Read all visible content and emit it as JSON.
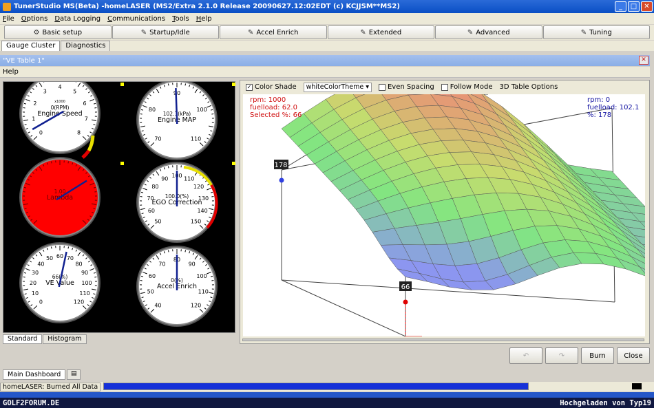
{
  "window": {
    "title": "TunerStudio MS(Beta)  -homeLASER (MS2/Extra 2.1.0 Release  20090627.12:02EDT (c) KCJJSM**MS2)"
  },
  "menu": [
    "File",
    "Options",
    "Data Logging",
    "Communications",
    "Tools",
    "Help"
  ],
  "toolbar": [
    {
      "label": "Basic setup",
      "icon": "basic-setup-icon"
    },
    {
      "label": "Startup/Idle",
      "icon": "startup-idle-icon"
    },
    {
      "label": "Accel Enrich",
      "icon": "accel-enrich-icon"
    },
    {
      "label": "Extended",
      "icon": "extended-icon"
    },
    {
      "label": "Advanced",
      "icon": "advanced-icon"
    },
    {
      "label": "Tuning",
      "icon": "tuning-icon"
    }
  ],
  "main_tabs": [
    "Gauge Cluster",
    "Diagnostics"
  ],
  "inner_window": {
    "title": "\"VE Table 1\"",
    "menu_help": "Help"
  },
  "gauges": [
    {
      "name": "engine-speed-gauge",
      "label": "Engine Speed",
      "unit": "0(RPM)",
      "scale": "x1000",
      "ticks": [
        "0",
        "1",
        "2",
        "3",
        "4",
        "5",
        "6",
        "7",
        "8"
      ],
      "face": "#ffffff"
    },
    {
      "name": "engine-map-gauge",
      "label": "Engine MAP",
      "unit": "102.1(kPa)",
      "ticks": [
        "70",
        "80",
        "90",
        "100",
        "110"
      ],
      "face": "#ffffff"
    },
    {
      "name": "lambda-gauge",
      "label": "Lambda",
      "unit": "1.00",
      "ticks": [],
      "face": "#ff0000"
    },
    {
      "name": "ego-correction-gauge",
      "label": "EGO Correction",
      "unit": "100.0(%)",
      "ticks": [
        "50",
        "60",
        "70",
        "80",
        "90",
        "100",
        "110",
        "120",
        "130",
        "140",
        "150"
      ],
      "face": "#ffffff"
    },
    {
      "name": "ve-value-gauge",
      "label": "VE Value",
      "unit": "66(%)",
      "ticks": [
        "0",
        "10",
        "20",
        "30",
        "40",
        "50",
        "60",
        "70",
        "80",
        "90",
        "100",
        "110",
        "120"
      ],
      "face": "#ffffff"
    },
    {
      "name": "accel-enrich-gauge",
      "label": "Accel Enrich",
      "unit": "0(%)",
      "ticks": [
        "40",
        "50",
        "60",
        "70",
        "80",
        "90",
        "100",
        "110",
        "120"
      ],
      "face": "#ffffff"
    }
  ],
  "gauge_subtabs": [
    "Standard",
    "Histogram"
  ],
  "options3d": {
    "color_shade": "Color Shade",
    "theme": "whiteColorTheme",
    "even_spacing": "Even Spacing",
    "follow_mode": "Follow Mode",
    "table_options": "3D Table Options"
  },
  "readout_left": {
    "rpm": "rpm: 1000",
    "fuelload": "fuelload: 62.0",
    "selected": "Selected %: 66"
  },
  "readout_right": {
    "rpm": "rpm: 0",
    "fuelload": "fuelload: 102.1",
    "pct": "%: 178"
  },
  "markers": {
    "left": "178",
    "bottom": "66"
  },
  "buttons": {
    "burn": "Burn",
    "close": "Close"
  },
  "dashboard_tab": "Main Dashboard",
  "status": {
    "message": "homeLASER: Burned All Data",
    "progress": 1.0
  },
  "watermark": {
    "left": "GOLF2FORUM.DE",
    "right": "Hochgeladen von Typ19"
  }
}
